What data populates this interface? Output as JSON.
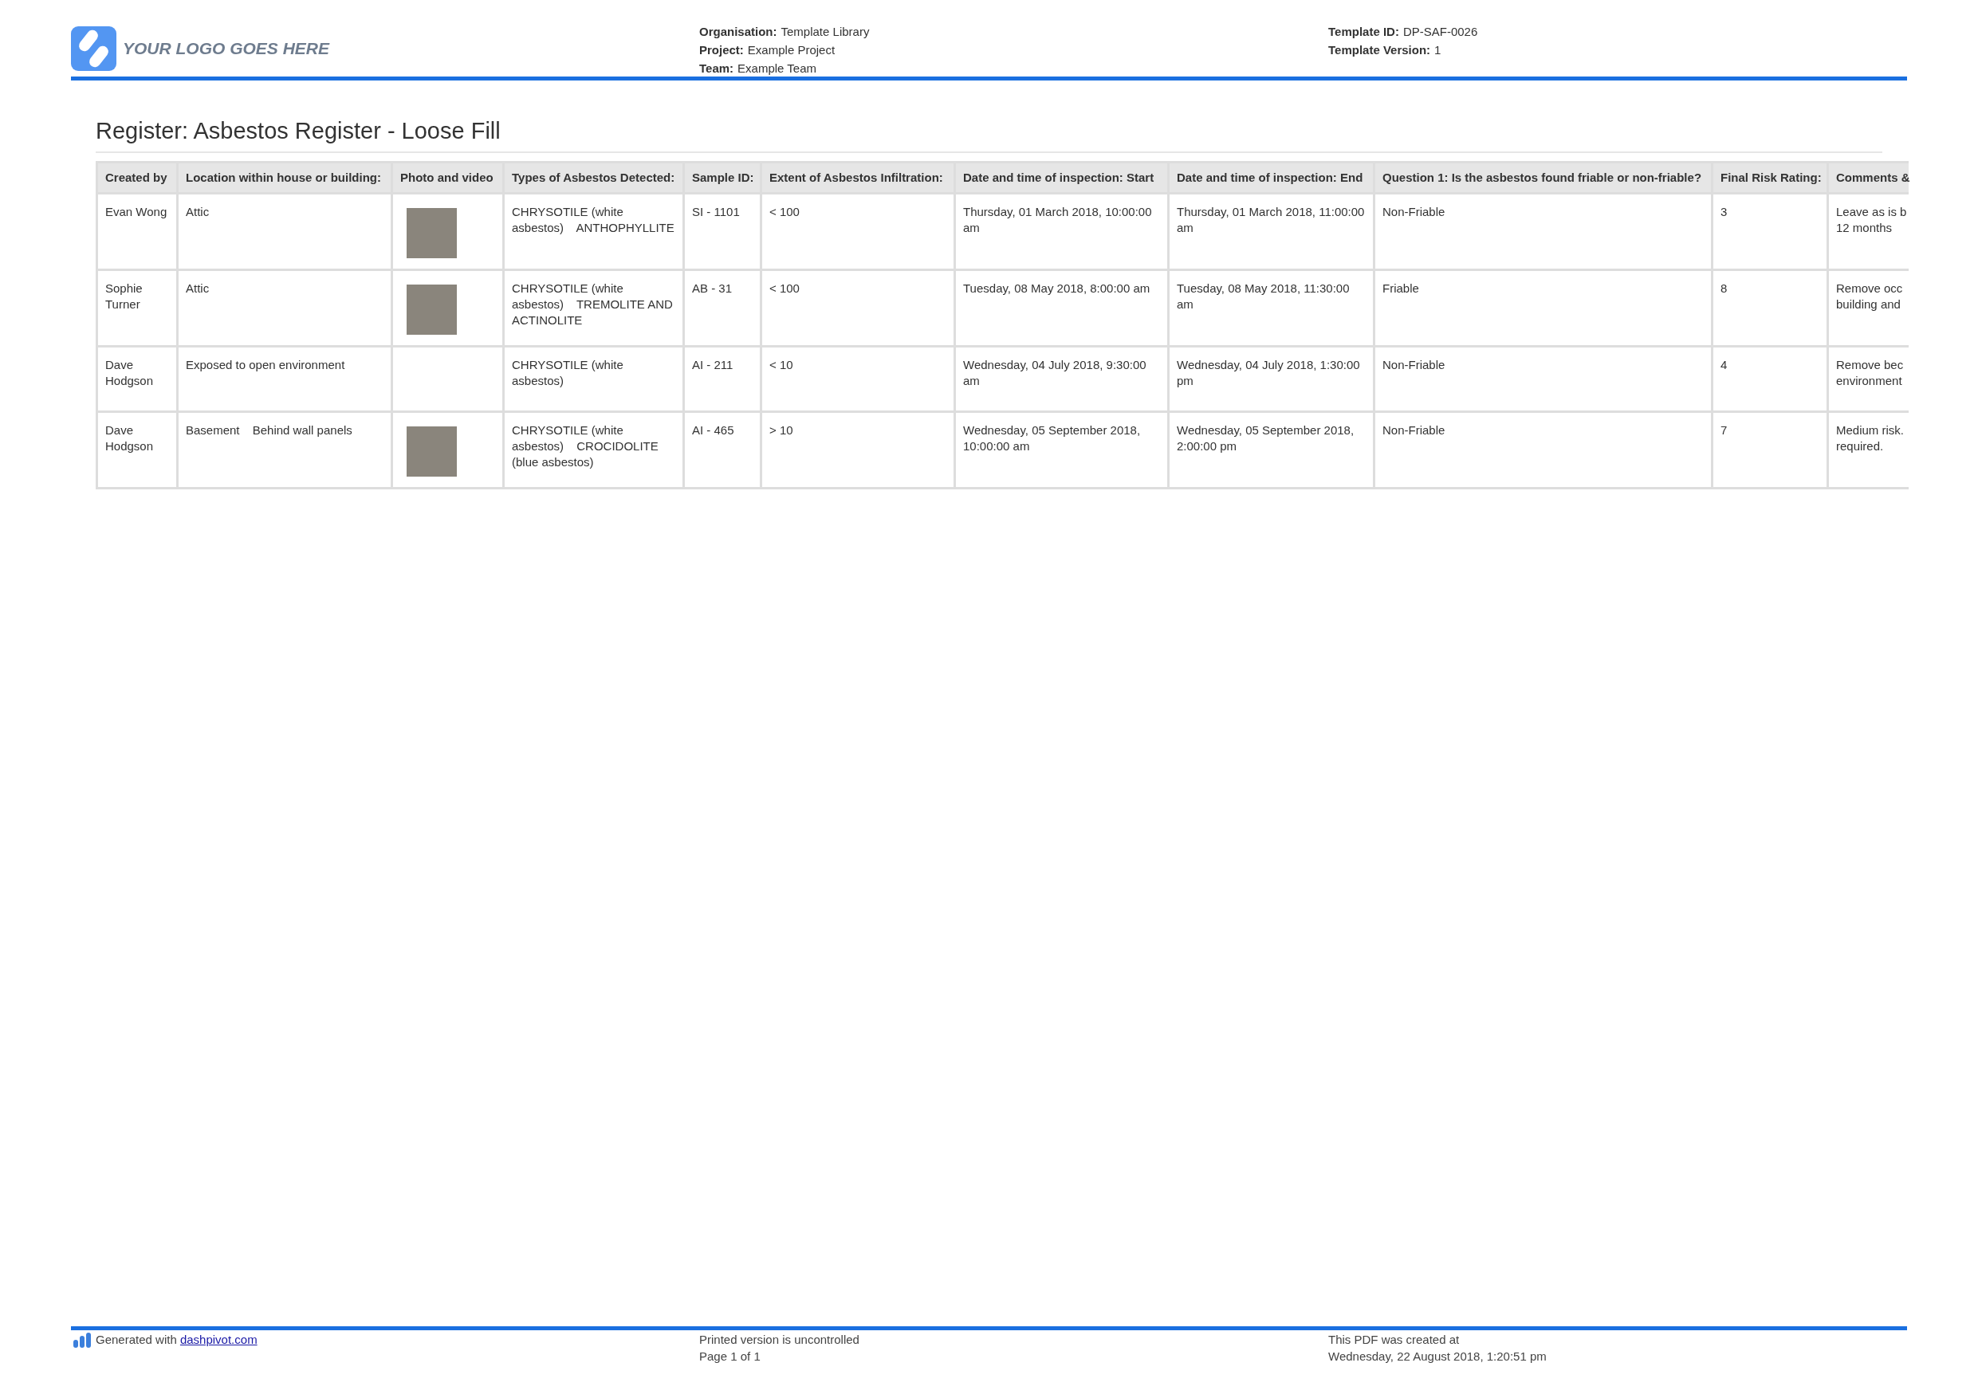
{
  "header": {
    "logo": {
      "text": "YOUR LOGO GOES HERE"
    },
    "project_info": [
      {
        "label": "Organisation:",
        "value": "Template Library"
      },
      {
        "label": "Project:",
        "value": "Example Project"
      },
      {
        "label": "Team:",
        "value": "Example Team"
      }
    ],
    "template_info": [
      {
        "label": "Template ID:",
        "value": "DP-SAF-0026"
      },
      {
        "label": "Template Version:",
        "value": "1"
      }
    ]
  },
  "register": {
    "title": "Register: Asbestos Register - Loose Fill",
    "table": {
      "columns": [
        "Created by",
        "Location within house or building:",
        "Photo and video",
        "Types of Asbestos Detected:",
        "Sample ID:",
        "Extent of Asbestos Infiltration:",
        "Date and time of inspection: Start",
        "Date and time of inspection: End",
        "Question 1: Is the asbestos found friable or non-friable?",
        "Final Risk Rating:",
        "Comments &"
      ],
      "rows": [
        {
          "cells": [
            {
              "kind": "text",
              "text": "Evan Wong"
            },
            {
              "kind": "multi",
              "values": [
                "Attic"
              ]
            },
            {
              "kind": "media",
              "photo": true
            },
            {
              "kind": "multi",
              "values": [
                "CHRYSOTILE (white asbestos)",
                "ANTHOPHYLLITE"
              ]
            },
            {
              "kind": "text",
              "text": "SI - 1101"
            },
            {
              "kind": "text",
              "text": "< 100"
            },
            {
              "kind": "text",
              "text": "Thursday, 01 March 2018, 10:00:00 am"
            },
            {
              "kind": "text",
              "text": "Thursday, 01 March 2018, 11:00:00 am"
            },
            {
              "kind": "text",
              "text": "Non-Friable"
            },
            {
              "kind": "text",
              "text": "3"
            },
            {
              "kind": "lines",
              "values": [
                "Leave as is b",
                "12 months"
              ]
            }
          ]
        },
        {
          "cells": [
            {
              "kind": "text",
              "text": "Sophie Turner"
            },
            {
              "kind": "multi",
              "values": [
                "Attic"
              ]
            },
            {
              "kind": "media",
              "photo": true
            },
            {
              "kind": "multi",
              "values": [
                "CHRYSOTILE (white asbestos)",
                "TREMOLITE AND ACTINOLITE"
              ]
            },
            {
              "kind": "text",
              "text": "AB - 31"
            },
            {
              "kind": "text",
              "text": "< 100"
            },
            {
              "kind": "text",
              "text": "Tuesday, 08 May 2018, 8:00:00 am"
            },
            {
              "kind": "text",
              "text": "Tuesday, 08 May 2018, 11:30:00 am"
            },
            {
              "kind": "text",
              "text": "Friable"
            },
            {
              "kind": "text",
              "text": "8"
            },
            {
              "kind": "lines",
              "values": [
                "Remove occ",
                "building and"
              ]
            }
          ]
        },
        {
          "cells": [
            {
              "kind": "text",
              "text": "Dave Hodgson"
            },
            {
              "kind": "multi",
              "values": [
                "Exposed to open environment"
              ]
            },
            {
              "kind": "media",
              "photo": false
            },
            {
              "kind": "multi",
              "values": [
                "CHRYSOTILE (white asbestos)"
              ]
            },
            {
              "kind": "text",
              "text": "AI - 211"
            },
            {
              "kind": "text",
              "text": "< 10"
            },
            {
              "kind": "text",
              "text": "Wednesday, 04 July 2018, 9:30:00 am"
            },
            {
              "kind": "text",
              "text": "Wednesday, 04 July 2018, 1:30:00 pm"
            },
            {
              "kind": "text",
              "text": "Non-Friable"
            },
            {
              "kind": "text",
              "text": "4"
            },
            {
              "kind": "lines",
              "values": [
                "Remove bec",
                "environment"
              ]
            }
          ]
        },
        {
          "cells": [
            {
              "kind": "text",
              "text": "Dave Hodgson"
            },
            {
              "kind": "multi",
              "values": [
                "Basement",
                "Behind wall panels"
              ]
            },
            {
              "kind": "media",
              "photo": true
            },
            {
              "kind": "multi",
              "values": [
                "CHRYSOTILE (white asbestos)",
                "CROCIDOLITE (blue asbestos)"
              ]
            },
            {
              "kind": "text",
              "text": "AI - 465"
            },
            {
              "kind": "text",
              "text": "> 10"
            },
            {
              "kind": "text",
              "text": "Wednesday, 05 September 2018, 10:00:00 am"
            },
            {
              "kind": "text",
              "text": "Wednesday, 05 September 2018, 2:00:00 pm"
            },
            {
              "kind": "text",
              "text": "Non-Friable"
            },
            {
              "kind": "text",
              "text": "7"
            },
            {
              "kind": "lines",
              "values": [
                "Medium risk.",
                "required."
              ]
            }
          ]
        }
      ]
    }
  },
  "footer": {
    "generated": {
      "text": "Generated with",
      "link": "dashpivot.com"
    },
    "notice": [
      "Printed version is uncontrolled",
      "Page 1 of 1"
    ],
    "created": [
      "This PDF was created at",
      "Wednesday, 22 August 2018, 1:20:51 pm"
    ]
  }
}
